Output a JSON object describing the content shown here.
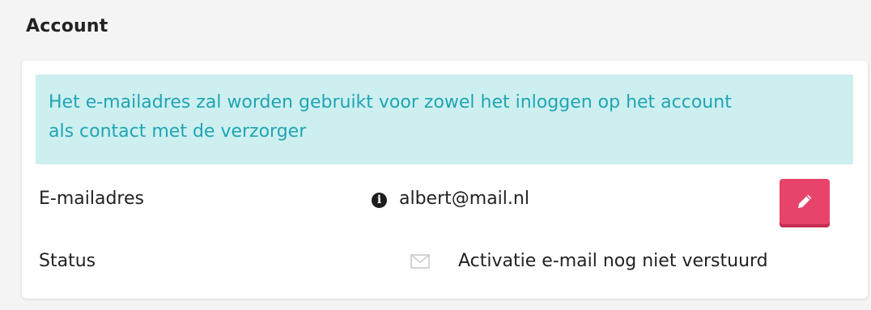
{
  "section": {
    "title": "Account"
  },
  "alert": {
    "line1": "Het e-mailadres zal worden gebruikt voor zowel het inloggen op het account",
    "line2": "als contact met de verzorger"
  },
  "email_row": {
    "label": "E-mailadres",
    "info_icon": "info-circle-icon",
    "value": "albert@mail.nl",
    "edit_icon": "pencil-icon"
  },
  "status_row": {
    "label": "Status",
    "mail_icon": "envelope-icon",
    "value": "Activatie e-mail nog niet verstuurd"
  },
  "colors": {
    "alert_bg": "#cdeff0",
    "alert_text": "#1fa5b3",
    "edit_button": "#e8436b"
  }
}
